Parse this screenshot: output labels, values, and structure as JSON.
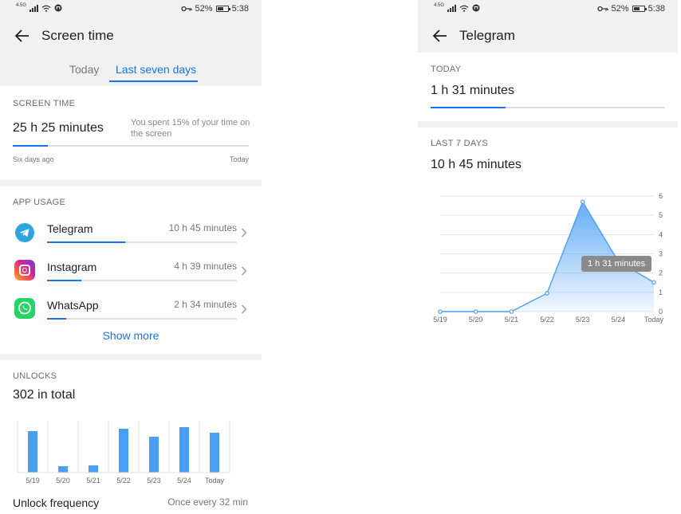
{
  "left": {
    "status": {
      "network": "4.5G",
      "battery": "52%",
      "time": "5:38"
    },
    "title": "Screen time",
    "tabs": [
      {
        "label": "Today"
      },
      {
        "label": "Last seven days"
      }
    ],
    "screen_time": {
      "section_label": "SCREEN TIME",
      "total": "25 h 25 minutes",
      "note": "You spent 15% of your time on the screen",
      "progress_fraction": 0.15,
      "start_label": "Six days ago",
      "end_label": "Today"
    },
    "app_usage": {
      "section_label": "APP USAGE",
      "apps": [
        {
          "name": "Telegram",
          "time": "10 h 45 minutes",
          "fraction": 0.41,
          "icon": "telegram-icon",
          "color": "#2ca5e0"
        },
        {
          "name": "Instagram",
          "time": "4 h 39 minutes",
          "fraction": 0.18,
          "icon": "instagram-icon",
          "color": "#d6249f"
        },
        {
          "name": "WhatsApp",
          "time": "2 h 34 minutes",
          "fraction": 0.1,
          "icon": "whatsapp-icon",
          "color": "#25d366"
        }
      ],
      "show_more": "Show more"
    },
    "unlocks": {
      "section_label": "UNLOCKS",
      "total": "302 in total",
      "frequency_label": "Unlock frequency",
      "frequency_value": "Once every 32 min"
    }
  },
  "right": {
    "status": {
      "network": "4.5G",
      "battery": "52%",
      "time": "5:38"
    },
    "title": "Telegram",
    "today": {
      "section_label": "TODAY",
      "value": "1 h 31 minutes",
      "progress_fraction": 0.32
    },
    "last7": {
      "section_label": "LAST 7 DAYS",
      "value": "10 h 45 minutes",
      "tooltip": "1 h 31 minutes"
    }
  },
  "chart_data": [
    {
      "type": "bar",
      "categories": [
        "5/19",
        "5/20",
        "5/21",
        "5/22",
        "5/23",
        "5/24",
        "Today"
      ],
      "values": [
        52,
        8,
        9,
        55,
        45,
        57,
        50
      ],
      "ylim": [
        0,
        65
      ],
      "grid": "vertical separators",
      "color": "#4a9ff5"
    },
    {
      "type": "area",
      "categories": [
        "5/19",
        "5/20",
        "5/21",
        "5/22",
        "5/23",
        "5/24",
        "Today"
      ],
      "values": [
        0,
        0,
        0,
        0.95,
        5.7,
        2.6,
        1.52
      ],
      "ylim": [
        0,
        6
      ],
      "yticks": [
        "0",
        "1",
        "2",
        "3",
        "4",
        "5",
        "6"
      ],
      "grid": "horizontal",
      "color": "#4a9ff5"
    }
  ]
}
